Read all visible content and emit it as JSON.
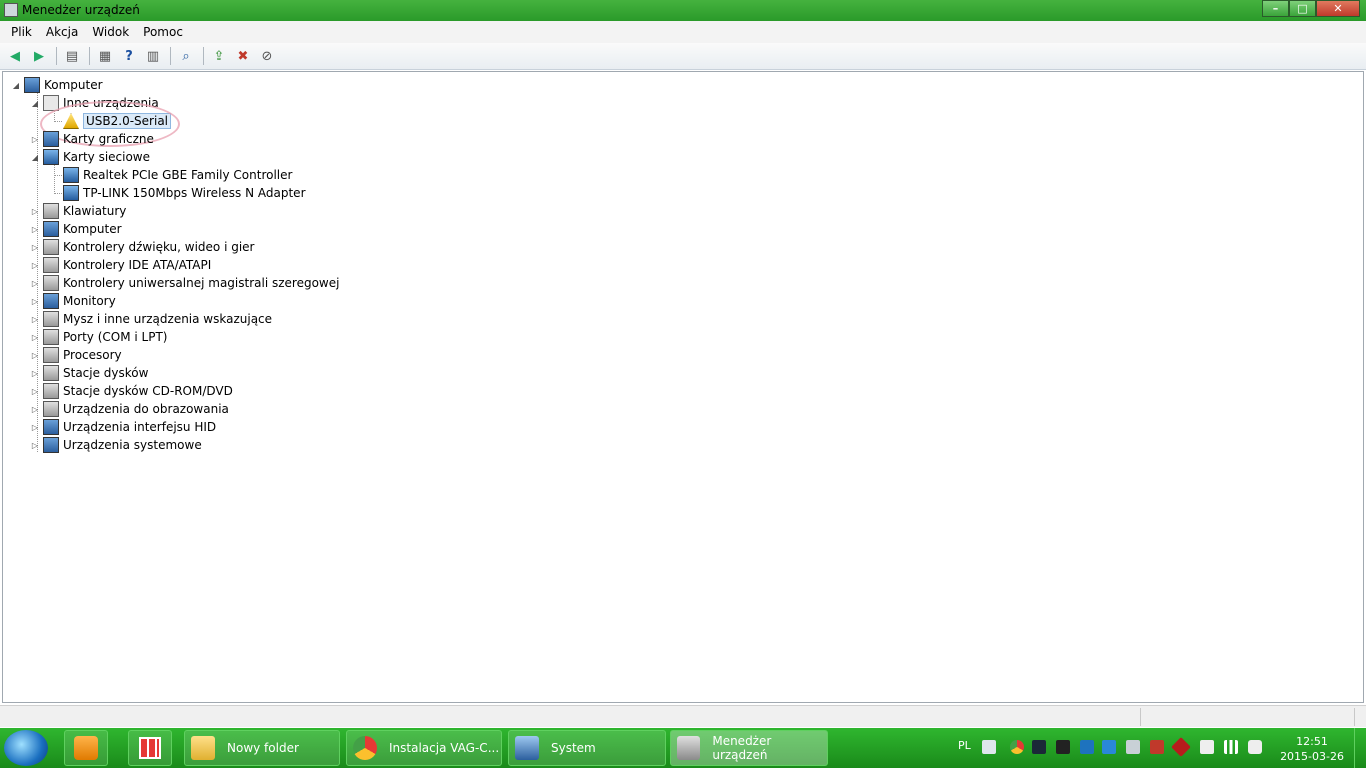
{
  "window": {
    "title": "Menedżer urządzeń",
    "controls": {
      "minimize": "–",
      "maximize": "□",
      "close": "✕"
    }
  },
  "menu": [
    "Plik",
    "Akcja",
    "Widok",
    "Pomoc"
  ],
  "toolbar": {
    "icons": [
      "back-icon",
      "forward-icon",
      "show-hide-console-tree-icon",
      "properties-icon",
      "help-icon",
      "show-action-pane-icon",
      "scan-hardware-icon",
      "update-driver-icon",
      "uninstall-icon",
      "disable-device-icon"
    ]
  },
  "tree": {
    "root": "Komputer",
    "other_devices": {
      "label": "Inne urządzenia",
      "children": [
        "USB2.0-Serial"
      ]
    },
    "display_adapters": "Karty graficzne",
    "network_adapters": {
      "label": "Karty sieciowe",
      "children": [
        "Realtek PCIe GBE Family Controller",
        "TP-LINK 150Mbps Wireless N Adapter"
      ]
    },
    "categories": [
      "Klawiatury",
      "Komputer",
      "Kontrolery dźwięku, wideo i gier",
      "Kontrolery IDE ATA/ATAPI",
      "Kontrolery uniwersalnej magistrali szeregowej",
      "Monitory",
      "Mysz i inne urządzenia wskazujące",
      "Porty (COM i LPT)",
      "Procesory",
      "Stacje dysków",
      "Stacje dysków CD-ROM/DVD",
      "Urządzenia do obrazowania",
      "Urządzenia interfejsu HID",
      "Urządzenia systemowe"
    ]
  },
  "taskbar": {
    "buttons": [
      {
        "label": "Nowy folder",
        "icon": "folder-icon"
      },
      {
        "label": "Instalacja VAG-C...",
        "icon": "chrome-icon"
      },
      {
        "label": "System",
        "icon": "system-icon"
      },
      {
        "label": "Menedżer urządzeń",
        "icon": "device-manager-icon"
      }
    ],
    "language": "PL",
    "time": "12:51",
    "date": "2015-03-26"
  },
  "colors": {
    "titlebar": "#3aa83a",
    "taskbar": "#1f9a1f",
    "selection": "#dbeaf8",
    "highlight_ellipse": "#e8a0b0"
  }
}
